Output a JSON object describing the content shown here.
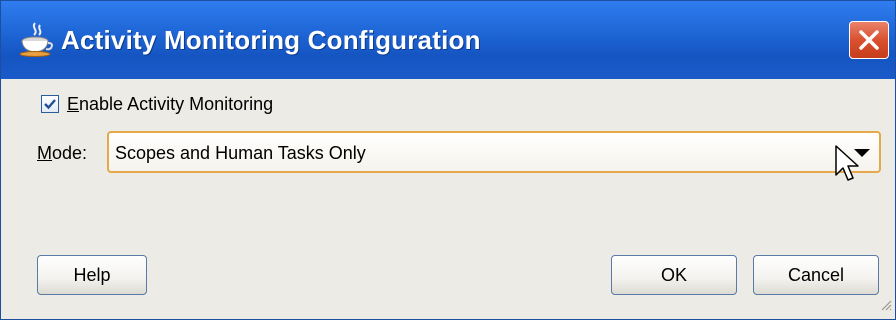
{
  "window": {
    "title": "Activity Monitoring Configuration",
    "title_icon": "java-coffee-cup-icon",
    "close_icon": "close-icon"
  },
  "enable_checkbox": {
    "label_mnemonic": "E",
    "label_rest": "nable Activity Monitoring",
    "checked": true
  },
  "mode": {
    "label_mnemonic": "M",
    "label_rest": "ode:",
    "selected_value": "Scopes and Human Tasks Only",
    "dropdown_icon": "chevron-down-icon"
  },
  "buttons": {
    "help": "Help",
    "ok": "OK",
    "cancel": "Cancel"
  },
  "colors": {
    "titlebar": "#1f66d6",
    "close_button": "#d9512f",
    "dialog_background": "#ecebe5",
    "combo_focus_border": "#e5a84a"
  }
}
